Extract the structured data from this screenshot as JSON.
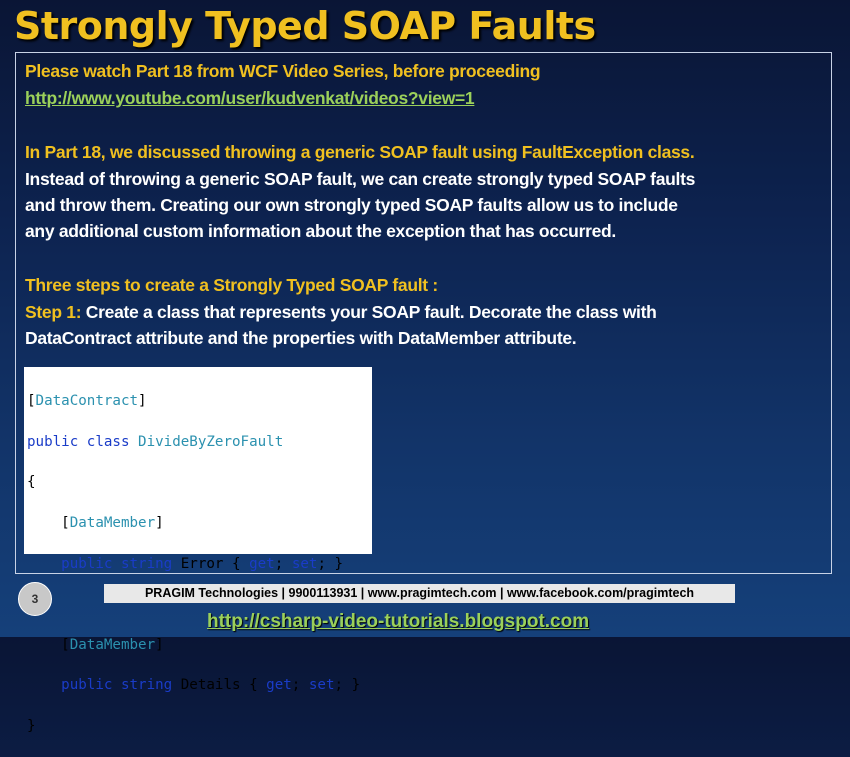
{
  "slide": {
    "title": "Strongly Typed SOAP Faults",
    "lines": {
      "l1": "Please watch Part 18 from WCF Video Series, before proceeding",
      "l2": "http://www.youtube.com/user/kudvenkat/videos?view=1",
      "l3": "In Part 18, we discussed throwing a generic SOAP fault using FaultException class.",
      "l4": "Instead of throwing a generic SOAP fault, we can create strongly typed SOAP faults",
      "l5": "and throw them. Creating our own strongly typed SOAP faults allow us to include",
      "l6": "any additional custom information about the exception that has occurred.",
      "l7": "Three steps to create a Strongly Typed SOAP fault :",
      "l8_label": "Step 1:",
      "l8_text": " Create a class that represents your SOAP fault. Decorate the class with",
      "l9": "DataContract attribute and the properties with DataMember attribute."
    },
    "code": {
      "c1_open": "[",
      "c1_attr": "DataContract",
      "c1_close": "]",
      "c2_kw": "public class ",
      "c2_type": "DivideByZeroFault",
      "c3": "{",
      "c4_open": "    [",
      "c4_attr": "DataMember",
      "c4_close": "]",
      "c5_kw": "    public string ",
      "c5_name": "Error { ",
      "c5_get": "get",
      "c5_mid": "; ",
      "c5_set": "set",
      "c5_end": "; }",
      "c6": "",
      "c7_open": "    [",
      "c7_attr": "DataMember",
      "c7_close": "]",
      "c8_kw": "    public string ",
      "c8_name": "Details { ",
      "c8_get": "get",
      "c8_mid": "; ",
      "c8_set": "set",
      "c8_end": "; }",
      "c9": "}"
    },
    "footer": {
      "page_number": "3",
      "company": "PRAGIM Technologies | 9900113931 | www.pragimtech.com | www.facebook.com/pragimtech",
      "blog_link": "http://csharp-video-tutorials.blogspot.com"
    },
    "colors": {
      "title": "#f0c020",
      "highlight": "#f0c020",
      "link": "#9bd05a",
      "body_text": "#ffffff",
      "background": "#0d2350"
    }
  }
}
